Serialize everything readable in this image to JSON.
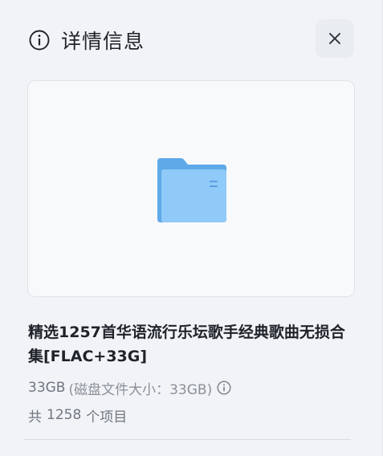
{
  "header": {
    "title": "详情信息",
    "info_icon": "info-circle-icon",
    "close_icon": "close-icon"
  },
  "preview": {
    "icon": "folder-icon",
    "folder_back_color": "#5fa9e9",
    "folder_front_color": "#8fcaf8"
  },
  "details": {
    "file_name": "精选1257首华语流行乐坛歌手经典歌曲无损合集[FLAC+33G]",
    "size": "33GB",
    "size_detail": "(磁盘文件大小：33GB)",
    "size_info_icon": "info-circle-icon",
    "count_prefix": "共",
    "item_count": "1258",
    "count_suffix": "个项目"
  },
  "colors": {
    "background": "#f1f3f6",
    "primary_text": "#1f2329",
    "secondary_text": "#777d86"
  }
}
